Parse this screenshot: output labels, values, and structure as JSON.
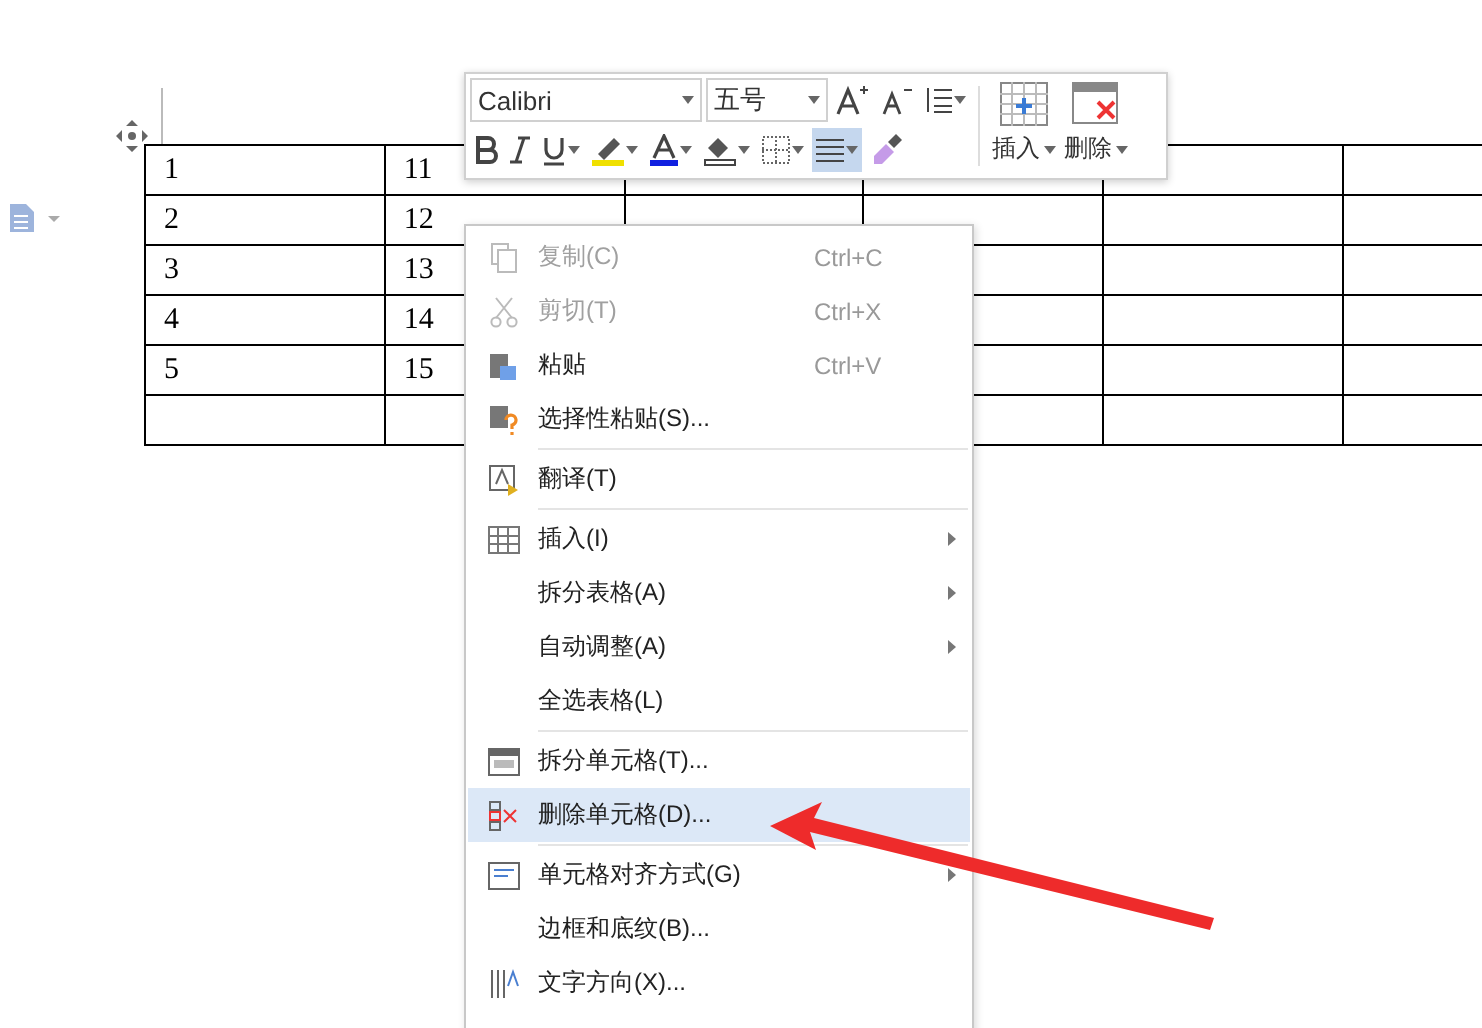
{
  "table": {
    "rows": [
      [
        "1",
        "11",
        "",
        "",
        "",
        ""
      ],
      [
        "2",
        "12",
        "",
        "",
        "",
        ""
      ],
      [
        "3",
        "13",
        "",
        "",
        "",
        ""
      ],
      [
        "4",
        "14",
        "",
        "",
        "",
        ""
      ],
      [
        "5",
        "15",
        "",
        "",
        "",
        ""
      ],
      [
        "",
        "",
        "",
        "",
        "",
        ""
      ]
    ]
  },
  "toolbar": {
    "font": "Calibri",
    "size": "五号",
    "align_selected": true,
    "insert_label": "插入",
    "delete_label": "删除"
  },
  "context_menu": [
    {
      "label": "复制(C)",
      "shortcut": "Ctrl+C",
      "disabled": true,
      "selected": false,
      "submenu": false,
      "kind": "copy",
      "separator_after": false
    },
    {
      "label": "剪切(T)",
      "shortcut": "Ctrl+X",
      "disabled": true,
      "selected": false,
      "submenu": false,
      "kind": "cut",
      "separator_after": false
    },
    {
      "label": "粘贴",
      "shortcut": "Ctrl+V",
      "disabled": false,
      "selected": false,
      "submenu": false,
      "kind": "paste",
      "separator_after": false
    },
    {
      "label": "选择性粘贴(S)...",
      "disabled": false,
      "selected": false,
      "submenu": false,
      "kind": "paste-special",
      "separator_after": true
    },
    {
      "label": "翻译(T)",
      "disabled": false,
      "selected": false,
      "submenu": false,
      "kind": "translate",
      "separator_after": true
    },
    {
      "label": "插入(I)",
      "disabled": false,
      "selected": false,
      "submenu": true,
      "kind": "table",
      "separator_after": false
    },
    {
      "label": "拆分表格(A)",
      "disabled": false,
      "selected": false,
      "submenu": true,
      "kind": "plain",
      "separator_after": false
    },
    {
      "label": "自动调整(A)",
      "disabled": false,
      "selected": false,
      "submenu": true,
      "kind": "plain",
      "separator_after": false
    },
    {
      "label": "全选表格(L)",
      "disabled": false,
      "selected": false,
      "submenu": false,
      "kind": "plain",
      "separator_after": true
    },
    {
      "label": "拆分单元格(T)...",
      "disabled": false,
      "selected": false,
      "submenu": false,
      "kind": "split",
      "separator_after": false
    },
    {
      "label": "删除单元格(D)...",
      "disabled": false,
      "selected": true,
      "submenu": false,
      "kind": "delete-cell",
      "separator_after": true
    },
    {
      "label": "单元格对齐方式(G)",
      "disabled": false,
      "selected": false,
      "submenu": true,
      "kind": "align",
      "separator_after": false
    },
    {
      "label": "边框和底纹(B)...",
      "disabled": false,
      "selected": false,
      "submenu": false,
      "kind": "plain",
      "separator_after": false
    },
    {
      "label": "文字方向(X)...",
      "disabled": false,
      "selected": false,
      "submenu": false,
      "kind": "direction",
      "separator_after": false
    }
  ]
}
